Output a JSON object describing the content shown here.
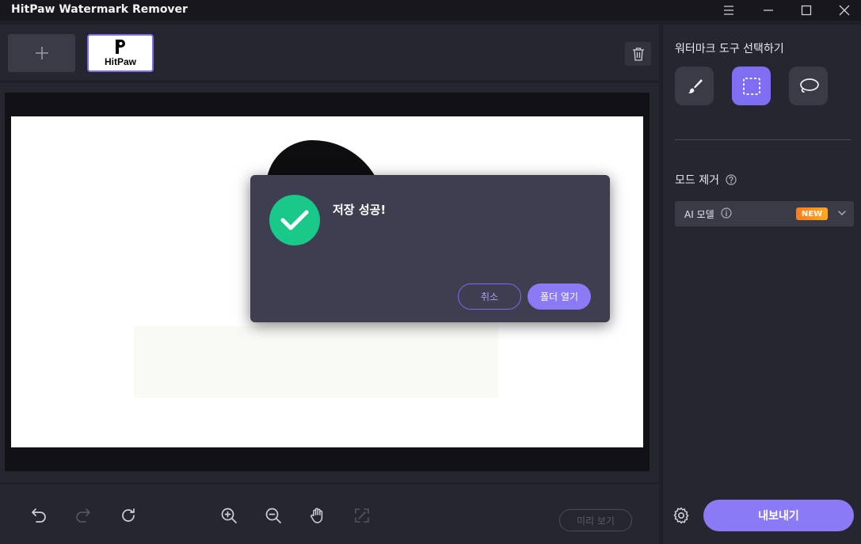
{
  "window": {
    "title": "HitPaw Watermark Remover",
    "controls": [
      "menu-icon",
      "minimize-icon",
      "maximize-icon",
      "close-icon"
    ]
  },
  "thumbnails": {
    "add_icon": "plus-icon",
    "items": [
      {
        "label": "HitPaw",
        "selected": true
      }
    ],
    "delete_icon": "trash-icon"
  },
  "toolbar": {
    "tools": [
      "undo-icon",
      "redo-icon",
      "refresh-icon",
      "zoom-in-icon",
      "zoom-out-icon",
      "hand-icon",
      "fit-icon"
    ],
    "preview_label": "미리 보기"
  },
  "panel": {
    "tool_title": "워터마크 도구 선택하기",
    "modes": [
      {
        "name": "brush-icon",
        "active": false
      },
      {
        "name": "rectangle-select-icon",
        "active": true
      },
      {
        "name": "lasso-icon",
        "active": false
      }
    ],
    "remove_title": "모드 제거",
    "model_select": {
      "value": "AI 모델",
      "badge": "NEW"
    },
    "export_label": "내보내기"
  },
  "dialog": {
    "message": "저장 성공!",
    "cancel_label": "취소",
    "open_label": "폴더 열기"
  },
  "colors": {
    "accent": "#8a7af5",
    "success": "#19c98a",
    "badge": "#ff8a1a"
  }
}
